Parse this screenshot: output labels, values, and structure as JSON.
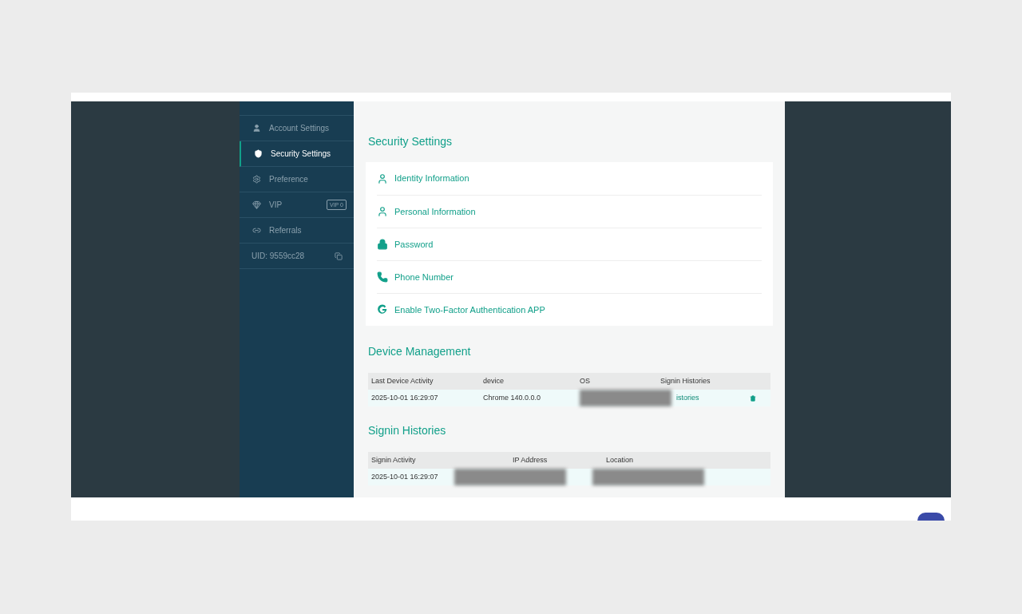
{
  "sidebar": {
    "items": [
      {
        "label": "Account Settings",
        "kind": "user",
        "selected": false
      },
      {
        "label": "Security Settings",
        "kind": "shield",
        "selected": true
      },
      {
        "label": "Preference",
        "kind": "gear",
        "selected": false
      },
      {
        "label": "VIP",
        "kind": "gem",
        "selected": false,
        "badge": "VIP 0"
      },
      {
        "label": "Referrals",
        "kind": "link",
        "selected": false
      }
    ],
    "uid": "UID: 9559cc28"
  },
  "security": {
    "title": "Security Settings",
    "items": [
      {
        "label": "Identity Information",
        "kind": "user"
      },
      {
        "label": "Personal Information",
        "kind": "user"
      },
      {
        "label": "Password",
        "kind": "lock"
      },
      {
        "label": "Phone Number",
        "kind": "phone"
      },
      {
        "label": "Enable Two-Factor Authentication APP",
        "kind": "google"
      }
    ]
  },
  "devices": {
    "title": "Device Management",
    "columns": [
      "Last Device Activity",
      "device",
      "OS",
      "Signin Histories"
    ],
    "rows": [
      {
        "activity": "2025-10-01 16:29:07",
        "device": "Chrome 140.0.0.0",
        "link": "istories"
      }
    ]
  },
  "signins": {
    "title": "Signin Histories",
    "columns": [
      "Signin Activity",
      "IP Address",
      "Location"
    ],
    "rows": [
      {
        "activity": "2025-10-01 16:29:07"
      }
    ]
  }
}
